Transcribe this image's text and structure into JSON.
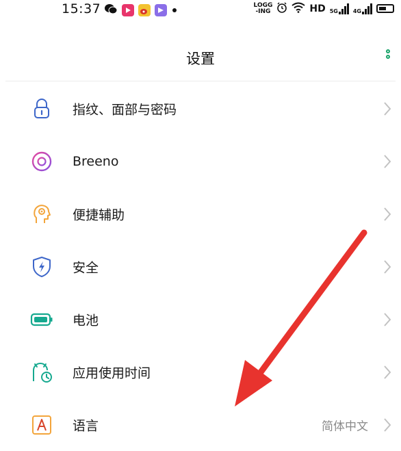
{
  "status_bar": {
    "time": "15:37",
    "left_icons": [
      "wechat-icon",
      "video-app-icon",
      "weibo-icon",
      "app-icon",
      "notification-dot-icon"
    ],
    "right_icons": [
      "logging-icon",
      "alarm-icon",
      "wifi-icon",
      "hd-icon",
      "signal-5g-icon",
      "signal-4g-icon",
      "battery-icon"
    ],
    "logging_label": "LOGG\n-ING",
    "hd_label": "HD",
    "net1_label": "5G",
    "net2_label": "4G"
  },
  "header": {
    "title": "设置"
  },
  "settings": {
    "items": [
      {
        "label": "指纹、面部与密码",
        "icon": "lock-icon",
        "value": ""
      },
      {
        "label": "Breeno",
        "icon": "breeno-icon",
        "value": ""
      },
      {
        "label": "便捷辅助",
        "icon": "assist-head-icon",
        "value": ""
      },
      {
        "label": "安全",
        "icon": "shield-bolt-icon",
        "value": ""
      },
      {
        "label": "电池",
        "icon": "battery-setting-icon",
        "value": ""
      },
      {
        "label": "应用使用时间",
        "icon": "app-usage-time-icon",
        "value": ""
      },
      {
        "label": "语言",
        "icon": "language-a-icon",
        "value": "简体中文"
      }
    ]
  },
  "colors": {
    "accent_green": "#1aa36a",
    "arrow_red": "#e8332e",
    "icon_blue": "#3d66c9",
    "icon_pink": "#d14aa8",
    "icon_orange": "#f3a53b",
    "icon_teal": "#16a98f"
  }
}
